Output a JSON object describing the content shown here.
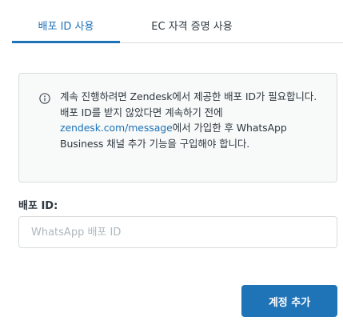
{
  "tabs": [
    {
      "label": "배포 ID 사용",
      "active": true
    },
    {
      "label": "EC 자격 증명 사용",
      "active": false
    }
  ],
  "notice": {
    "icon": "info-icon",
    "text_before_link": "계속 진행하려면 Zendesk에서 제공한 배포 ID가 필요합니다. 배포 ID를 받지 않았다면 계속하기 전에 ",
    "link_text": "zendesk.com/message",
    "text_after_link": "에서 가입한 후 WhatsApp Business 채널 추가 기능을 구입해야 합니다."
  },
  "form": {
    "label": "배포 ID:",
    "placeholder": "WhatsApp 배포 ID",
    "value": ""
  },
  "actions": {
    "submit_label": "계정 추가"
  },
  "colors": {
    "accent": "#1f73b7",
    "border": "#d8dcde",
    "notice_bg": "#f8f9f9",
    "text": "#2f3941"
  }
}
